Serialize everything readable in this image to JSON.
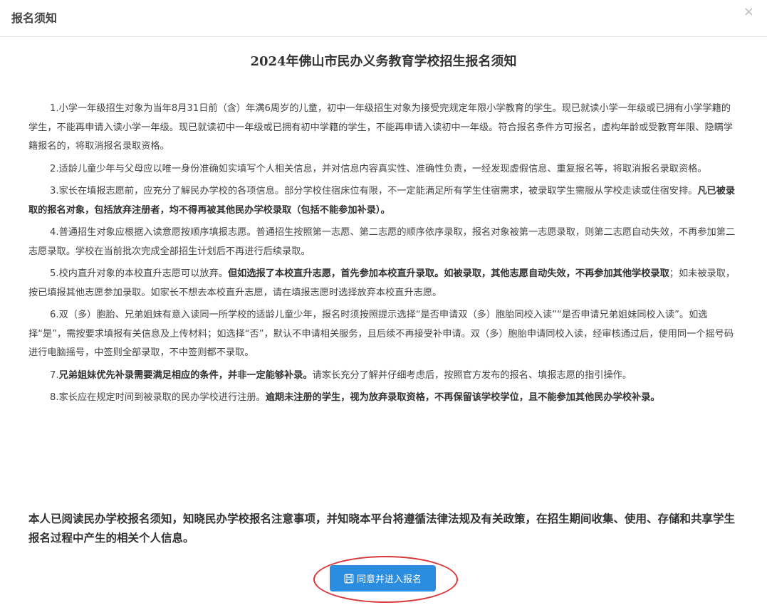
{
  "modal": {
    "title": "报名须知",
    "close": "×"
  },
  "document": {
    "title": "2024年佛山市民办义务教育学校招生报名须知",
    "rules": [
      {
        "normal": "1.小学一年级招生对象为当年8月31日前（含）年满6周岁的儿童，初中一年级招生对象为接受完规定年限小学教育的学生。现已就读小学一年级或已拥有小学学籍的学生，不能再申请入读小学一年级。现已就读初中一年级或已拥有初中学籍的学生，不能再申请入读初中一年级。符合报名条件方可报名，虚构年龄或受教育年限、隐瞒学籍报名的，将取消报名录取资格。",
        "bold": "",
        "tail": ""
      },
      {
        "normal": "2.适龄儿童少年与父母应以唯一身份准确如实填写个人相关信息，并对信息内容真实性、准确性负责，一经发现虚假信息、重复报名等，将取消报名录取资格。",
        "bold": "",
        "tail": ""
      },
      {
        "normal": "3.家长在填报志愿前，应充分了解民办学校的各项信息。部分学校住宿床位有限，不一定能满足所有学生住宿需求，被录取学生需服从学校走读或住宿安排。",
        "bold": "凡已被录取的报名对象，包括放弃注册者，均不得再被其他民办学校录取（包括不能参加补录）。",
        "tail": ""
      },
      {
        "normal": "4.普通招生对象应根据入读意愿按顺序填报志愿。普通招生按照第一志愿、第二志愿的顺序依序录取，报名对象被第一志愿录取，则第二志愿自动失效，不再参加第二志愿录取。学校在当前批次完成全部招生计划后不再进行后续录取。",
        "bold": "",
        "tail": ""
      },
      {
        "normal": "5.校内直升对象的本校直升志愿可以放弃。",
        "bold": "但如选报了本校直升志愿，首先参加本校直升录取。如被录取，其他志愿自动失效，不再参加其他学校录取",
        "tail": "；如未被录取，按已填报其他志愿参加录取。如家长不想去本校直升志愿，请在填报志愿时选择放弃本校直升志愿。"
      },
      {
        "normal": "6.双（多）胞胎、兄弟姐妹有意入读同一所学校的适龄儿童少年，报名时须按照提示选择“是否申请双（多）胞胎同校入读”“是否申请兄弟姐妹同校入读”。如选择“是”，需按要求填报有关信息及上传材料；如选择“否”，默认不申请相关服务，且后续不再接受补申请。双（多）胞胎申请同校入读，经审核通过后，使用同一个摇号码进行电脑摇号，中签则全部录取，不中签则都不录取。",
        "bold": "",
        "tail": ""
      },
      {
        "normal": "7.",
        "bold": "兄弟姐妹优先补录需要满足相应的条件，并非一定能够补录。",
        "tail": "请家长充分了解并仔细考虑后，按照官方发布的报名、填报志愿的指引操作。"
      },
      {
        "normal": "8.家长应在规定时间到被录取的民办学校进行注册。",
        "bold": "逾期未注册的学生，视为放弃录取资格，不再保留该学校学位，且不能参加其他民办学校补录。",
        "tail": ""
      }
    ],
    "consent": "本人已阅读民办学校报名须知，知晓民办学校报名注意事项，并知晓本平台将遵循法律法规及有关政策，在招生期间收集、使用、存储和共享学生报名过程中产生的相关个人信息。"
  },
  "actions": {
    "agree_label": "同意并进入报名",
    "agree_icon": "save-icon",
    "button_color": "#2b8de0",
    "highlight_color": "#d9383a"
  }
}
